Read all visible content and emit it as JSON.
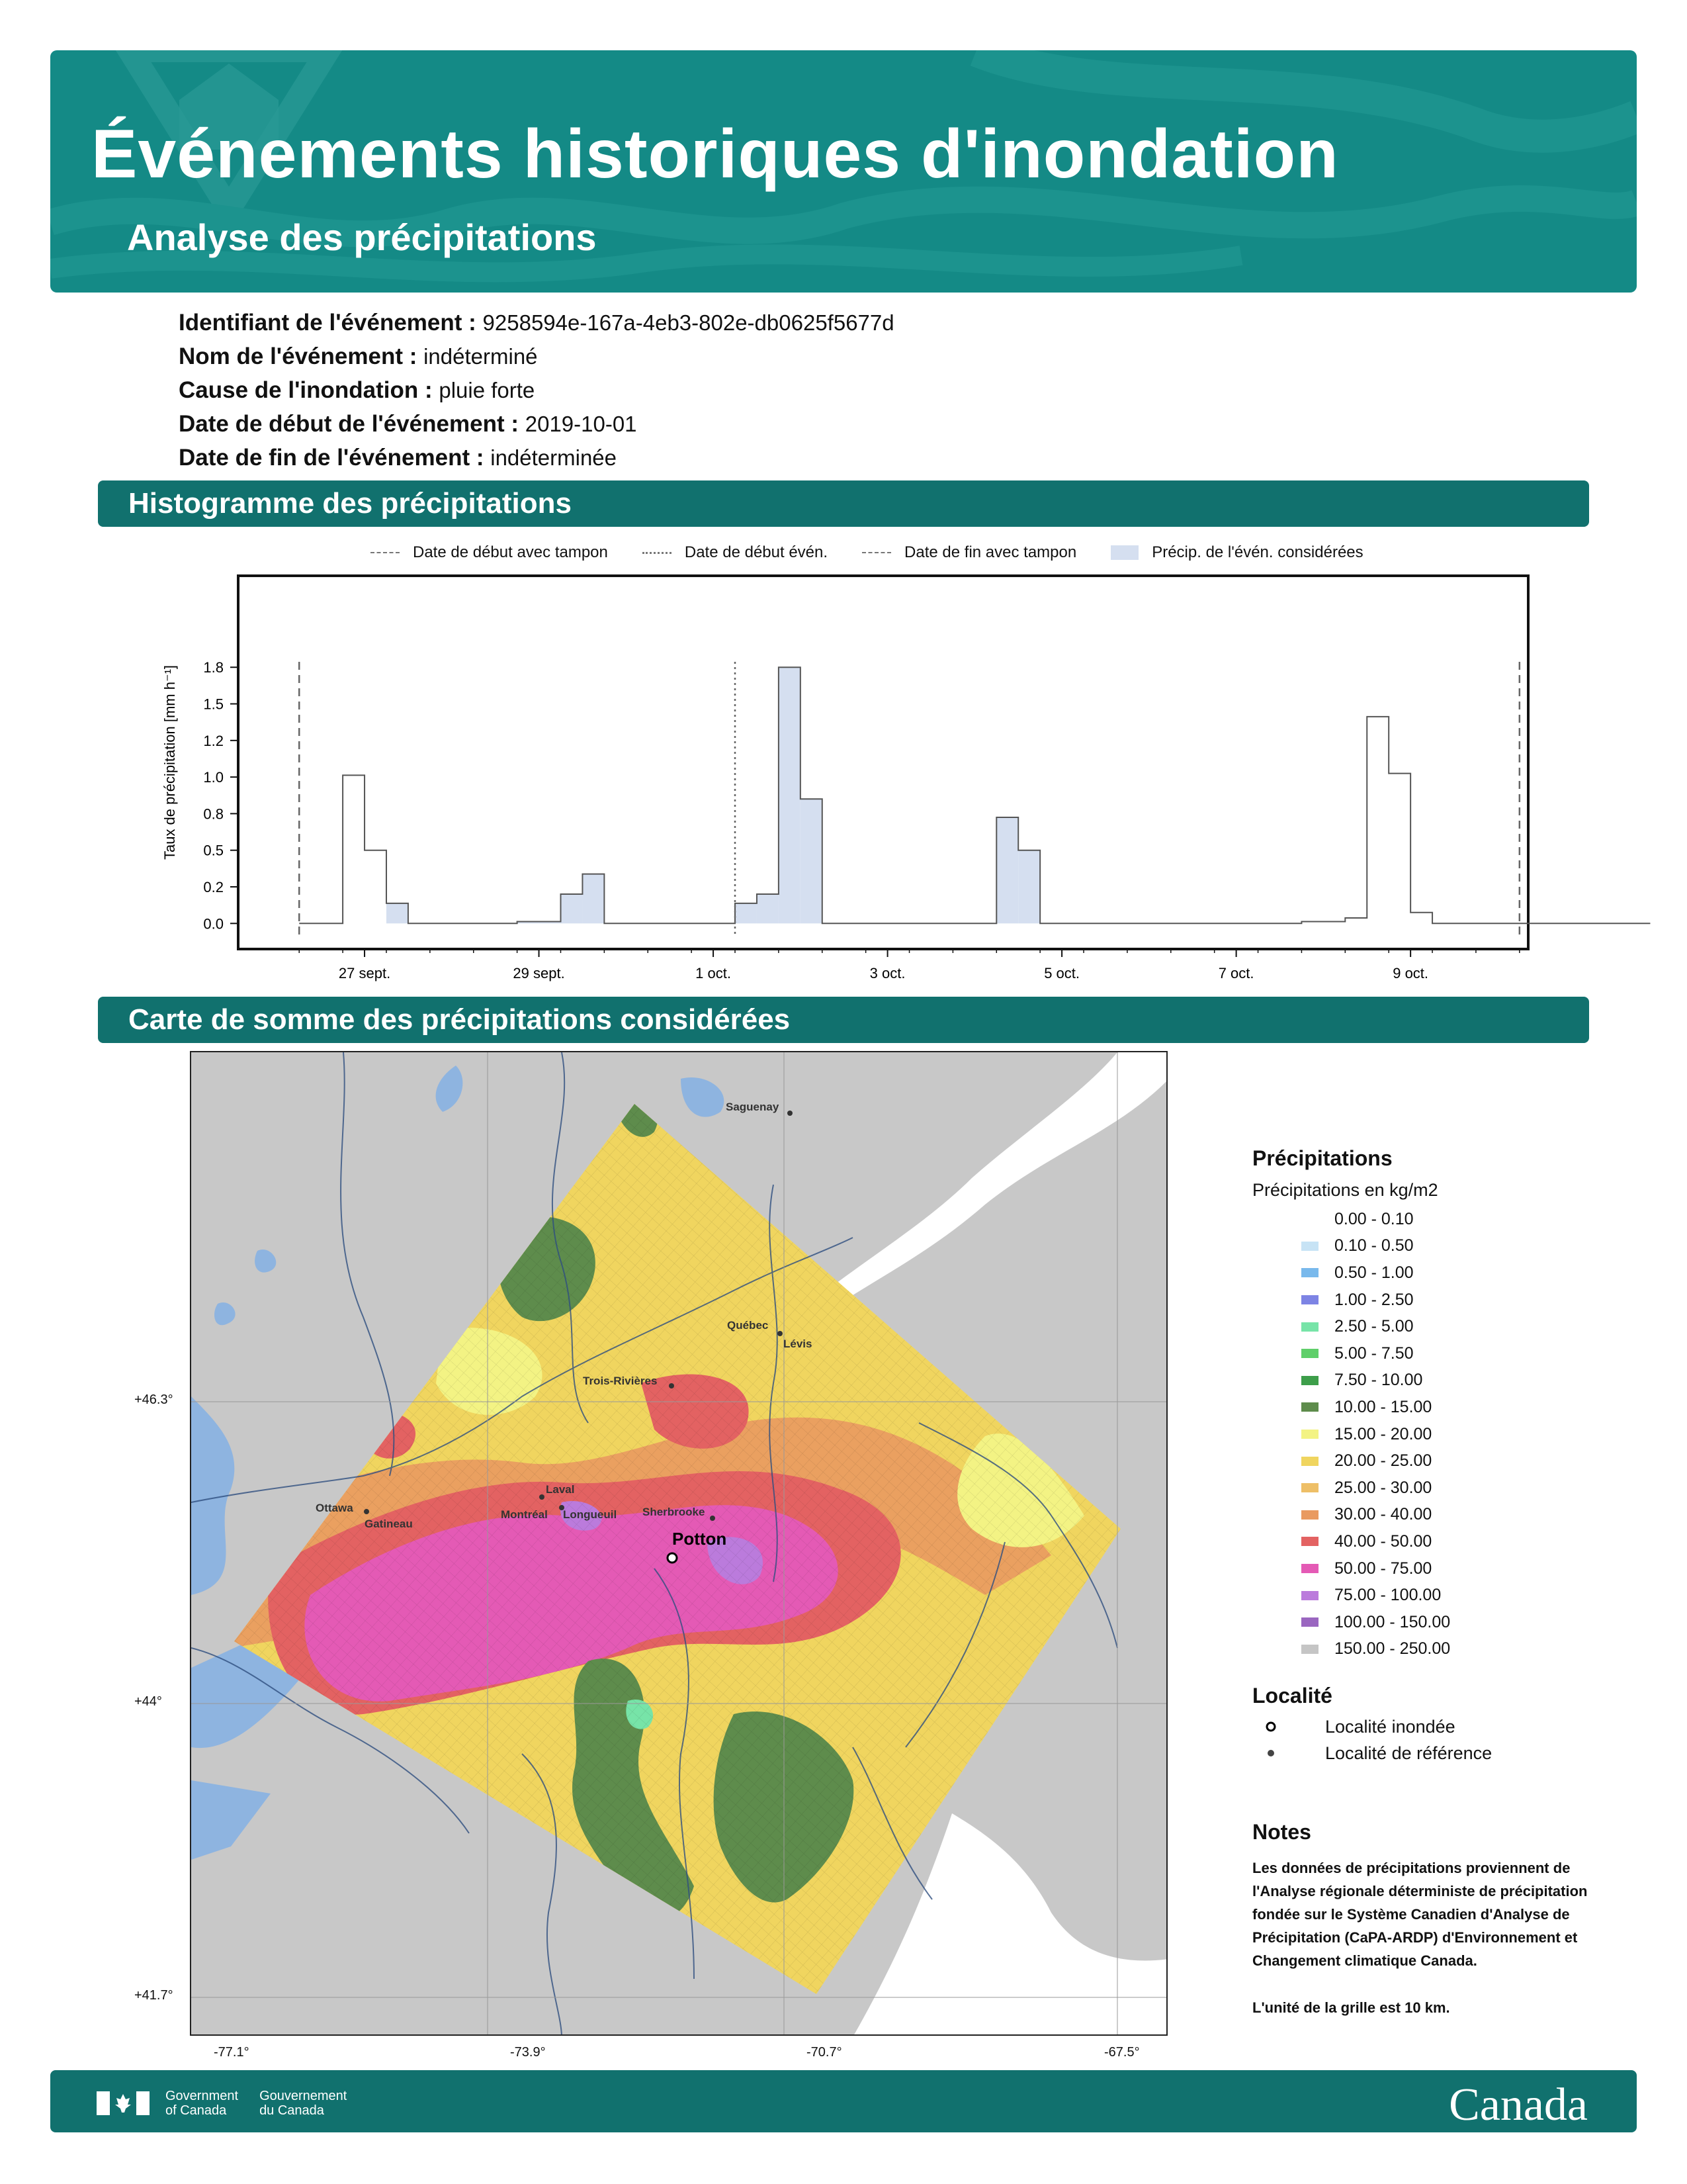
{
  "header": {
    "title": "Événements historiques d'inondation",
    "subtitle": "Analyse des précipitations"
  },
  "event": {
    "id_label": "Identifiant de l'événement :",
    "id_value": "9258594e-167a-4eb3-802e-db0625f5677d",
    "name_label": "Nom de l'événement :",
    "name_value": "indéterminé",
    "cause_label": "Cause de l'inondation :",
    "cause_value": "pluie forte",
    "start_label": "Date de début de l'événement :",
    "start_value": "2019-10-01",
    "end_label": "Date de fin de l'événement :",
    "end_value": "indéterminée"
  },
  "sections": {
    "histogram": "Histogramme des précipitations",
    "map": "Carte de somme des précipitations considérées"
  },
  "chart_data": {
    "type": "bar",
    "ylabel": "Taux de précipitation [mm h⁻¹]",
    "ylim": [
      -0.14,
      1.9
    ],
    "yticks": [
      {
        "v": 0.0,
        "label": "0.0"
      },
      {
        "v": 0.2,
        "label": "0.2"
      },
      {
        "v": 0.4,
        "label": "0.5"
      },
      {
        "v": 0.6,
        "label": "0.8"
      },
      {
        "v": 0.8,
        "label": "1.0"
      },
      {
        "v": 1.0,
        "label": "1.2"
      },
      {
        "v": 1.2,
        "label": "1.5"
      },
      {
        "v": 1.4,
        "label": "1.8"
      }
    ],
    "xlim": [
      -0.7,
      14.1
    ],
    "xticks": [
      {
        "v": 0.75,
        "label": "27 sept."
      },
      {
        "v": 2.75,
        "label": "29 sept."
      },
      {
        "v": 4.75,
        "label": "1 oct."
      },
      {
        "v": 6.75,
        "label": "3 oct."
      },
      {
        "v": 8.75,
        "label": "5 oct."
      },
      {
        "v": 10.75,
        "label": "7 oct."
      },
      {
        "v": 12.75,
        "label": "9 oct."
      }
    ],
    "bin_start": 0,
    "bin_width": 0.25,
    "values": [
      0.0,
      0.0,
      0.81,
      0.4,
      0.11,
      0.0,
      0.0,
      0.0,
      0.0,
      0.0,
      0.01,
      0.01,
      0.16,
      0.27,
      0.0,
      0.0,
      0.0,
      0.0,
      0.0,
      0.0,
      0.11,
      0.16,
      1.4,
      0.68,
      0.0,
      0.0,
      0.0,
      0.0,
      0.0,
      0.0,
      0.0,
      0.0,
      0.58,
      0.4,
      0.0,
      0.0,
      0.0,
      0.0,
      0.0,
      0.0,
      0.0,
      0.0,
      0.0,
      0.0,
      0.0,
      0.0,
      0.01,
      0.01,
      0.03,
      1.13,
      0.82,
      0.06,
      0.0,
      0.0,
      0.0,
      0.0,
      0.0,
      0.0,
      0.0,
      0.0,
      0.0,
      0.0
    ],
    "considered_range": [
      1.0,
      9.0
    ],
    "lines": {
      "buffer_start": 0.0,
      "event_start": 5.0,
      "buffer_end": 14.0
    },
    "legend": {
      "buffer_start": "Date de début avec tampon",
      "event_start": "Date de début évén.",
      "buffer_end": "Date de fin avec tampon",
      "considered": "Précip. de l'évén. considérées"
    }
  },
  "map": {
    "lon_labels": [
      "-77.1°",
      "-73.9°",
      "-70.7°",
      "-67.5°"
    ],
    "lat_labels": [
      "+46.3°",
      "+44°",
      "+41.7°"
    ],
    "places": [
      {
        "name": "Saguenay"
      },
      {
        "name": "Québec"
      },
      {
        "name": "Lévis"
      },
      {
        "name": "Trois-Rivières"
      },
      {
        "name": "Laval"
      },
      {
        "name": "Ottawa"
      },
      {
        "name": "Gatineau"
      },
      {
        "name": "Montréal"
      },
      {
        "name": "Longueuil"
      },
      {
        "name": "Sherbrooke"
      }
    ],
    "flooded": "Potton"
  },
  "legend": {
    "precip_title": "Précipitations",
    "precip_sub": "Précipitations en kg/m2",
    "bins": [
      {
        "label": "0.00 - 0.10",
        "color": "#ffffff"
      },
      {
        "label": "0.10 - 0.50",
        "color": "#c7e3f5"
      },
      {
        "label": "0.50 - 1.00",
        "color": "#79b9ec"
      },
      {
        "label": "1.00 - 2.50",
        "color": "#7d84e4"
      },
      {
        "label": "2.50 - 5.00",
        "color": "#77e4a8"
      },
      {
        "label": "5.00 - 7.50",
        "color": "#5fcf6a"
      },
      {
        "label": "7.50 - 10.00",
        "color": "#3d9e4a"
      },
      {
        "label": "10.00 - 15.00",
        "color": "#5e8c4c"
      },
      {
        "label": "15.00 - 20.00",
        "color": "#f3f384"
      },
      {
        "label": "20.00 - 25.00",
        "color": "#f0d55f"
      },
      {
        "label": "25.00 - 30.00",
        "color": "#eebf67"
      },
      {
        "label": "30.00 - 40.00",
        "color": "#e99a60"
      },
      {
        "label": "40.00 - 50.00",
        "color": "#e36262"
      },
      {
        "label": "50.00 - 75.00",
        "color": "#e45ab5"
      },
      {
        "label": "75.00 - 100.00",
        "color": "#bb7bdc"
      },
      {
        "label": "100.00 - 150.00",
        "color": "#9a66c0"
      },
      {
        "label": "150.00 - 250.00",
        "color": "#c5c5c5"
      }
    ],
    "loc_title": "Localité",
    "loc_flooded": "Localité inondée",
    "loc_reference": "Localité de référence",
    "notes_title": "Notes",
    "notes_text": "Les données de précipitations proviennent de l'Analyse régionale déterministe de précipitation fondée sur le Système Canadien d'Analyse de Précipitation (CaPA-ARDP) d'Environnement et Changement climatique Canada.",
    "notes_grid": "L'unité de la grille est 10 km."
  },
  "footer": {
    "gov_en_1": "Government",
    "gov_en_2": "of Canada",
    "gov_fr_1": "Gouvernement",
    "gov_fr_2": "du Canada",
    "wordmark": "Canada"
  }
}
